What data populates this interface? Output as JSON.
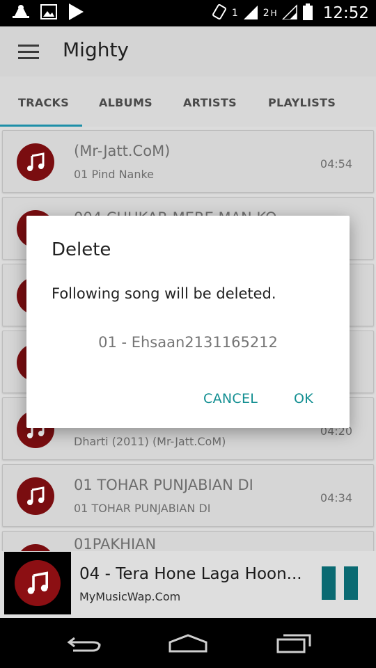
{
  "status_bar": {
    "sim1": "1",
    "sim2": "2",
    "network": "H",
    "time": "12:52",
    "icons": [
      "android-debug-icon",
      "image-icon",
      "play-store-icon",
      "vibrate-icon",
      "signal-icon",
      "battery-icon"
    ]
  },
  "app": {
    "title": "Mighty",
    "tabs": [
      "TRACKS",
      "ALBUMS",
      "ARTISTS",
      "PLAYLISTS"
    ],
    "active_tab": "TRACKS",
    "accent_color": "#1d8fa8"
  },
  "tracks": [
    {
      "title": "(Mr-Jatt.CoM)",
      "subtitle": "01 Pind Nanke",
      "duration": "04:54"
    },
    {
      "title": "004 CHUKAR MERE MAN KO",
      "subtitle": "",
      "duration": ""
    },
    {
      "title": "",
      "subtitle": "",
      "duration": ""
    },
    {
      "title": "",
      "subtitle": "",
      "duration": ""
    },
    {
      "title": "",
      "subtitle": "Dharti (2011) (Mr-Jatt.CoM)",
      "duration": "04:20"
    },
    {
      "title": "01 TOHAR PUNJABIAN DI",
      "subtitle": "01 TOHAR PUNJABIAN DI",
      "duration": "04:34"
    },
    {
      "title": "01PAKHIAN",
      "subtitle": "",
      "duration": ""
    }
  ],
  "player": {
    "title": "04 - Tera Hone Laga Hoon...",
    "artist": "MyMusicWap.Com",
    "accent_color": "#0a6a72"
  },
  "dialog": {
    "title": "Delete",
    "message": "Following song will be deleted.",
    "song": "01 - Ehsaan2131165212",
    "cancel_label": "CANCEL",
    "ok_label": "OK",
    "button_color": "#138f92"
  }
}
